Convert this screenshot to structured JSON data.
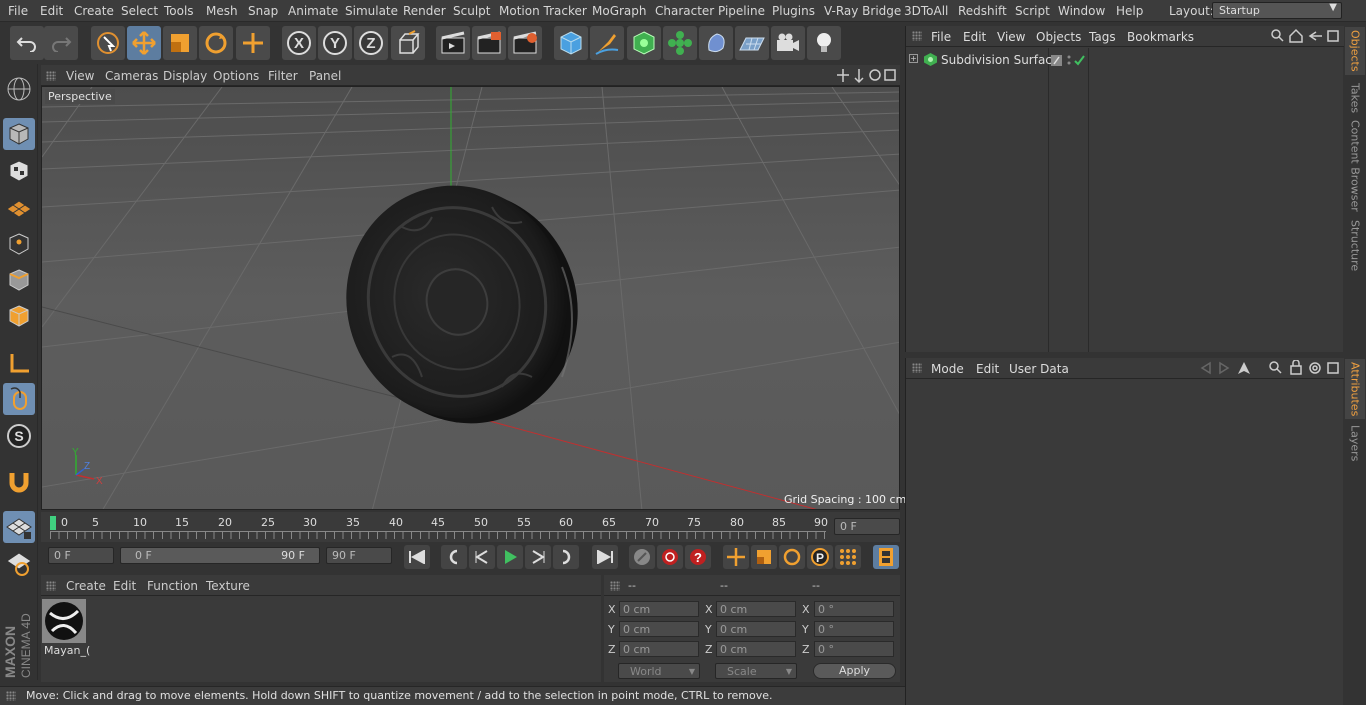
{
  "menubar": {
    "items": [
      "File",
      "Edit",
      "Create",
      "Select",
      "Tools",
      "Mesh",
      "Snap",
      "Animate",
      "Simulate",
      "Render",
      "Sculpt",
      "Motion Tracker",
      "MoGraph",
      "Character",
      "Pipeline",
      "Plugins",
      "V-Ray Bridge",
      "3DToAll",
      "Redshift",
      "Script",
      "Window",
      "Help"
    ],
    "layout_label": "Layout:",
    "layout_value": "Startup"
  },
  "viewport": {
    "menu": [
      "View",
      "Cameras",
      "Display",
      "Options",
      "Filter",
      "Panel"
    ],
    "camera_label": "Perspective",
    "grid_spacing": "Grid Spacing : 100 cm",
    "axis_labels": {
      "y": "Y",
      "z": "Z",
      "x": "X"
    }
  },
  "timeline": {
    "ticks": [
      "0",
      "5",
      "10",
      "15",
      "20",
      "25",
      "30",
      "35",
      "40",
      "45",
      "50",
      "55",
      "60",
      "65",
      "70",
      "75",
      "80",
      "85",
      "90"
    ],
    "current_frame": "0 F"
  },
  "transport": {
    "start_field": "0 F",
    "range_start": "0 F",
    "range_end": "90 F",
    "end_field": "90 F"
  },
  "materials": {
    "menu": [
      "Create",
      "Edit",
      "Function",
      "Texture"
    ],
    "items": [
      {
        "name": "Mayan_("
      }
    ]
  },
  "coordinates": {
    "headers": [
      "--",
      "--",
      "--"
    ],
    "rows": [
      {
        "axis": "X",
        "pos": "0 cm",
        "size_axis": "X",
        "size": "0 cm",
        "rot_axis": "X",
        "rot": "0 °"
      },
      {
        "axis": "Y",
        "pos": "0 cm",
        "size_axis": "Y",
        "size": "0 cm",
        "rot_axis": "Y",
        "rot": "0 °"
      },
      {
        "axis": "Z",
        "pos": "0 cm",
        "size_axis": "Z",
        "size": "0 cm",
        "rot_axis": "Z",
        "rot": "0 °"
      }
    ],
    "world_select": "World",
    "scale_select": "Scale",
    "apply_label": "Apply"
  },
  "objects_panel": {
    "menu": [
      "File",
      "Edit",
      "View",
      "Objects",
      "Tags",
      "Bookmarks"
    ],
    "tree": [
      {
        "name": "Subdivision Surface"
      }
    ]
  },
  "attributes_panel": {
    "menu": [
      "Mode",
      "Edit",
      "User Data"
    ]
  },
  "right_tabs": [
    "Objects",
    "Takes",
    "Content Browser",
    "Structure",
    "Attributes",
    "Layers"
  ],
  "branding": {
    "maxon": "MAXON",
    "cinema": "CINEMA 4D"
  },
  "status": "Move: Click and drag to move elements. Hold down SHIFT to quantize movement / add to the selection in point mode, CTRL to remove.",
  "colors": {
    "accent": "#6f8fb3",
    "tab_active": "#f0a040",
    "x_axis": "#d03030",
    "y_axis": "#30b030",
    "playhead": "#40d080"
  }
}
